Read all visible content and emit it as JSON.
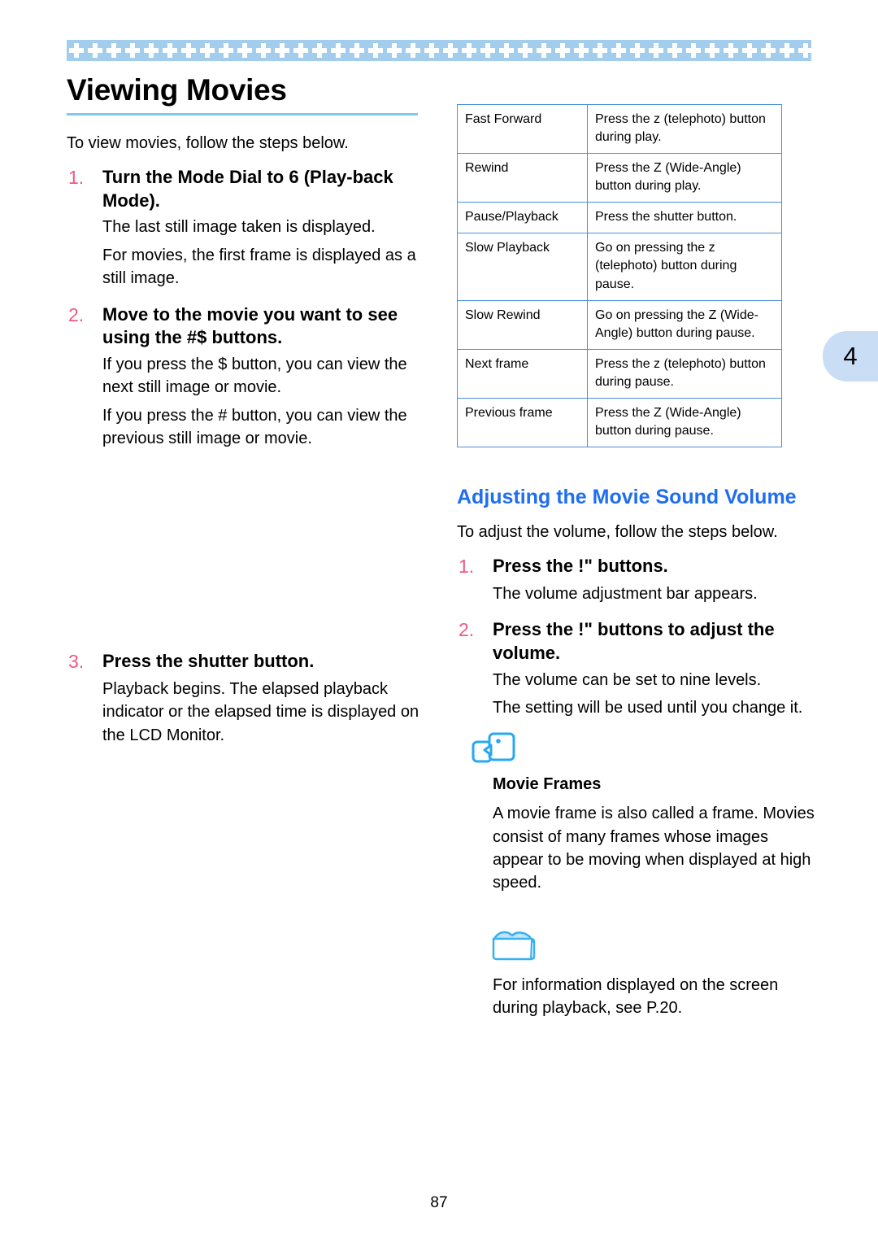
{
  "page": {
    "title": "Viewing Movies",
    "number": "87",
    "tab_label": "4"
  },
  "left_column": {
    "lead": "To view movies, follow the steps below.",
    "steps": [
      {
        "num": "1.",
        "heading": "Turn the Mode Dial to 6   (Play-back Mode).",
        "body": [
          "The last still image taken is displayed.",
          "For movies, the first frame is displayed as a still image."
        ]
      },
      {
        "num": "2.",
        "heading": "Move to the movie you want to see using the #$   buttons.",
        "body": [
          "If you press the $  button, you can view the next still image or movie.",
          "If you press the #  button, you can view the previous still image or movie."
        ]
      },
      {
        "num": "3.",
        "heading": "Press the shutter button.",
        "body": [
          "Playback begins. The elapsed playback indicator or the elapsed time is displayed on the LCD Monitor."
        ]
      }
    ]
  },
  "right_column": {
    "table": {
      "rows": [
        {
          "operation": "Fast Forward",
          "action": "Press the z   (telephoto) button during play."
        },
        {
          "operation": "Rewind",
          "action": "Press the Z   (Wide-Angle) button during play."
        },
        {
          "operation": "Pause/Playback",
          "action": "Press the shutter button."
        },
        {
          "operation": "Slow Playback",
          "action": "Go on pressing the z   (telephoto) button during pause."
        },
        {
          "operation": "Slow Rewind",
          "action": "Go on pressing the Z   (Wide-Angle) button during pause."
        },
        {
          "operation": "Next frame",
          "action": "Press the z   (telephoto) button during pause."
        },
        {
          "operation": "Previous frame",
          "action": "Press the Z   (Wide-Angle) button during pause."
        }
      ]
    },
    "subheading": "Adjusting the Movie Sound Volume",
    "lead": "To adjust the volume, follow the steps below.",
    "steps": [
      {
        "num": "1.",
        "heading": "Press the !\"    buttons.",
        "body": [
          "The volume adjustment bar appears."
        ]
      },
      {
        "num": "2.",
        "heading": "Press the !\"   buttons to adjust the volume.",
        "body": [
          "The volume can be set to nine levels.",
          "The setting will be used until you change it."
        ]
      }
    ],
    "notes": [
      {
        "icon": "terms-speech-bubble-icon",
        "title": "Movie Frames",
        "body": "A movie frame is also called a frame. Movies consist of many frames whose images appear to be moving when displayed at high speed."
      },
      {
        "icon": "folder-reference-icon",
        "title": "",
        "body": "For information displayed on the screen during playback, see P.20."
      }
    ]
  },
  "colors": {
    "band": "#a3cdec",
    "rule": "#7ec8ef",
    "step_number": "#f2577f",
    "subheading": "#1f6ef0",
    "table_border": "#4a90d9",
    "tab": "#c9ddf5"
  }
}
